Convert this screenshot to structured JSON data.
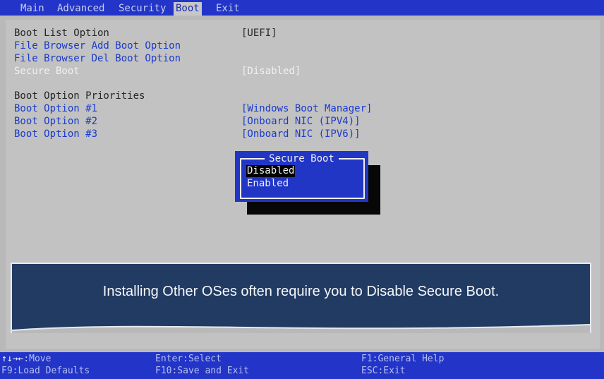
{
  "top_tabs": [
    {
      "label": "Main"
    },
    {
      "label": "Advanced"
    },
    {
      "label": "Security"
    },
    {
      "label": "Boot"
    },
    {
      "label": "Exit"
    }
  ],
  "settings": {
    "boot_list_option": {
      "label": "Boot List Option",
      "value": "[UEFI]"
    },
    "add_boot_option": {
      "label": "File Browser Add Boot Option"
    },
    "del_boot_option": {
      "label": "File Browser Del Boot Option"
    },
    "secure_boot": {
      "label": "Secure Boot",
      "value": "[Disabled]"
    },
    "priorities_heading": "Boot Option Priorities",
    "boot_options": [
      {
        "label": "Boot Option #1",
        "value": "[Windows Boot Manager]"
      },
      {
        "label": "Boot Option #2",
        "value": "[Onboard NIC (IPV4)]"
      },
      {
        "label": "Boot Option #3",
        "value": "[Onboard NIC (IPV6)]"
      }
    ]
  },
  "popup": {
    "title": "Secure Boot",
    "options": [
      {
        "label": "Disabled",
        "selected": true
      },
      {
        "label": "Enabled",
        "selected": false
      }
    ]
  },
  "banner": {
    "text": "Installing Other OSes often require you to Disable Secure Boot."
  },
  "footer": {
    "move_icon": "↑↓→←",
    "move": ":Move",
    "select": "Enter:Select",
    "help": "F1:General Help",
    "load_defaults": "F9:Load Defaults",
    "save_exit": "F10:Save and Exit",
    "esc_exit": "ESC:Exit"
  },
  "colors": {
    "bios_blue": "#2235c8",
    "panel_gray": "#c2c2c2",
    "link_blue": "#1a3bcc",
    "banner_navy": "#223b63"
  }
}
